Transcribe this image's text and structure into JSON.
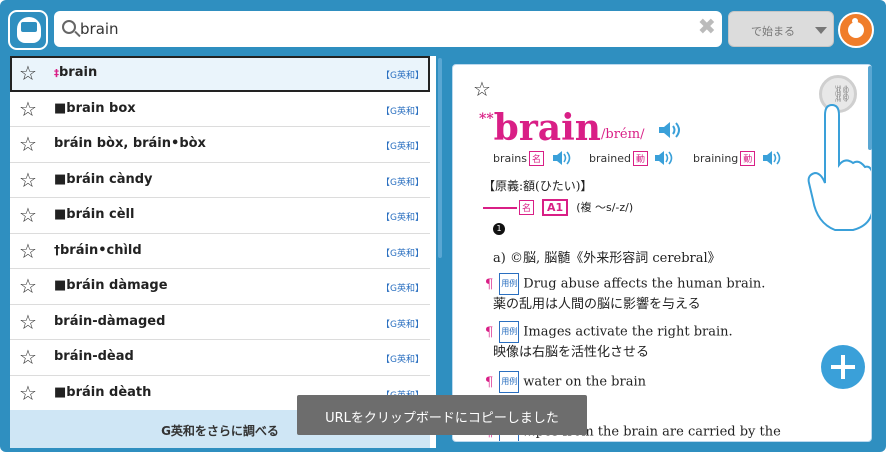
{
  "header": {
    "search_value": "brain",
    "mode_label": "で始まる"
  },
  "list": {
    "items": [
      {
        "prefix": "‡",
        "headword": "brain",
        "tag": "【G英和】",
        "selected": true
      },
      {
        "prefix": "■",
        "headword": "brain box",
        "tag": "【G英和】"
      },
      {
        "prefix": "",
        "headword": "bráin bòx, bráin•bòx",
        "tag": "【G英和】"
      },
      {
        "prefix": "■",
        "headword": "bráin càndy",
        "tag": "【G英和】"
      },
      {
        "prefix": "■",
        "headword": "bráin cèll",
        "tag": "【G英和】"
      },
      {
        "prefix": "†",
        "headword": "bráin•chìld",
        "tag": "【G英和】"
      },
      {
        "prefix": "■",
        "headword": "bráin dàmage",
        "tag": "【G英和】"
      },
      {
        "prefix": "",
        "headword": "bráin-dàmaged",
        "tag": "【G英和】"
      },
      {
        "prefix": "",
        "headword": "bráin-dèad",
        "tag": "【G英和】"
      },
      {
        "prefix": "■",
        "headword": "bráin dèath",
        "tag": "【G英和】"
      }
    ],
    "more_label": "G英和をさらに調べる"
  },
  "entry": {
    "stars": "**",
    "headword": "brain",
    "pronunciation": "/bréɪn/",
    "forms": [
      {
        "word": "brains",
        "pos": "名"
      },
      {
        "word": "brained",
        "pos": "動"
      },
      {
        "word": "braining",
        "pos": "動"
      }
    ],
    "origin": "【原義:額(ひたい)】",
    "gram_pos": "名",
    "cefr": "A1",
    "plural": "(複 〜s/-z/)",
    "sense_num": "1",
    "sense": "a) ©脳, 脳髄《外来形容詞 cerebral》",
    "examples": [
      {
        "label": "用例",
        "en": "Drug abuse affects the human brain.",
        "ja": "薬の乱用は人間の脳に影響を与える"
      },
      {
        "label": "用例",
        "en": "Images activate the right brain.",
        "ja": "映像は右脳を活性化させる"
      },
      {
        "label": "用例",
        "en": "water on the brain",
        "ja": ""
      },
      {
        "label": "用例",
        "en": "...pes from the brain are carried by the",
        "ja": ""
      }
    ]
  },
  "toast": "URLをクリップボードにコピーしました",
  "colors": {
    "frame": "#2f8fc0",
    "accent": "#d91f86",
    "link": "#2a6fc0"
  }
}
